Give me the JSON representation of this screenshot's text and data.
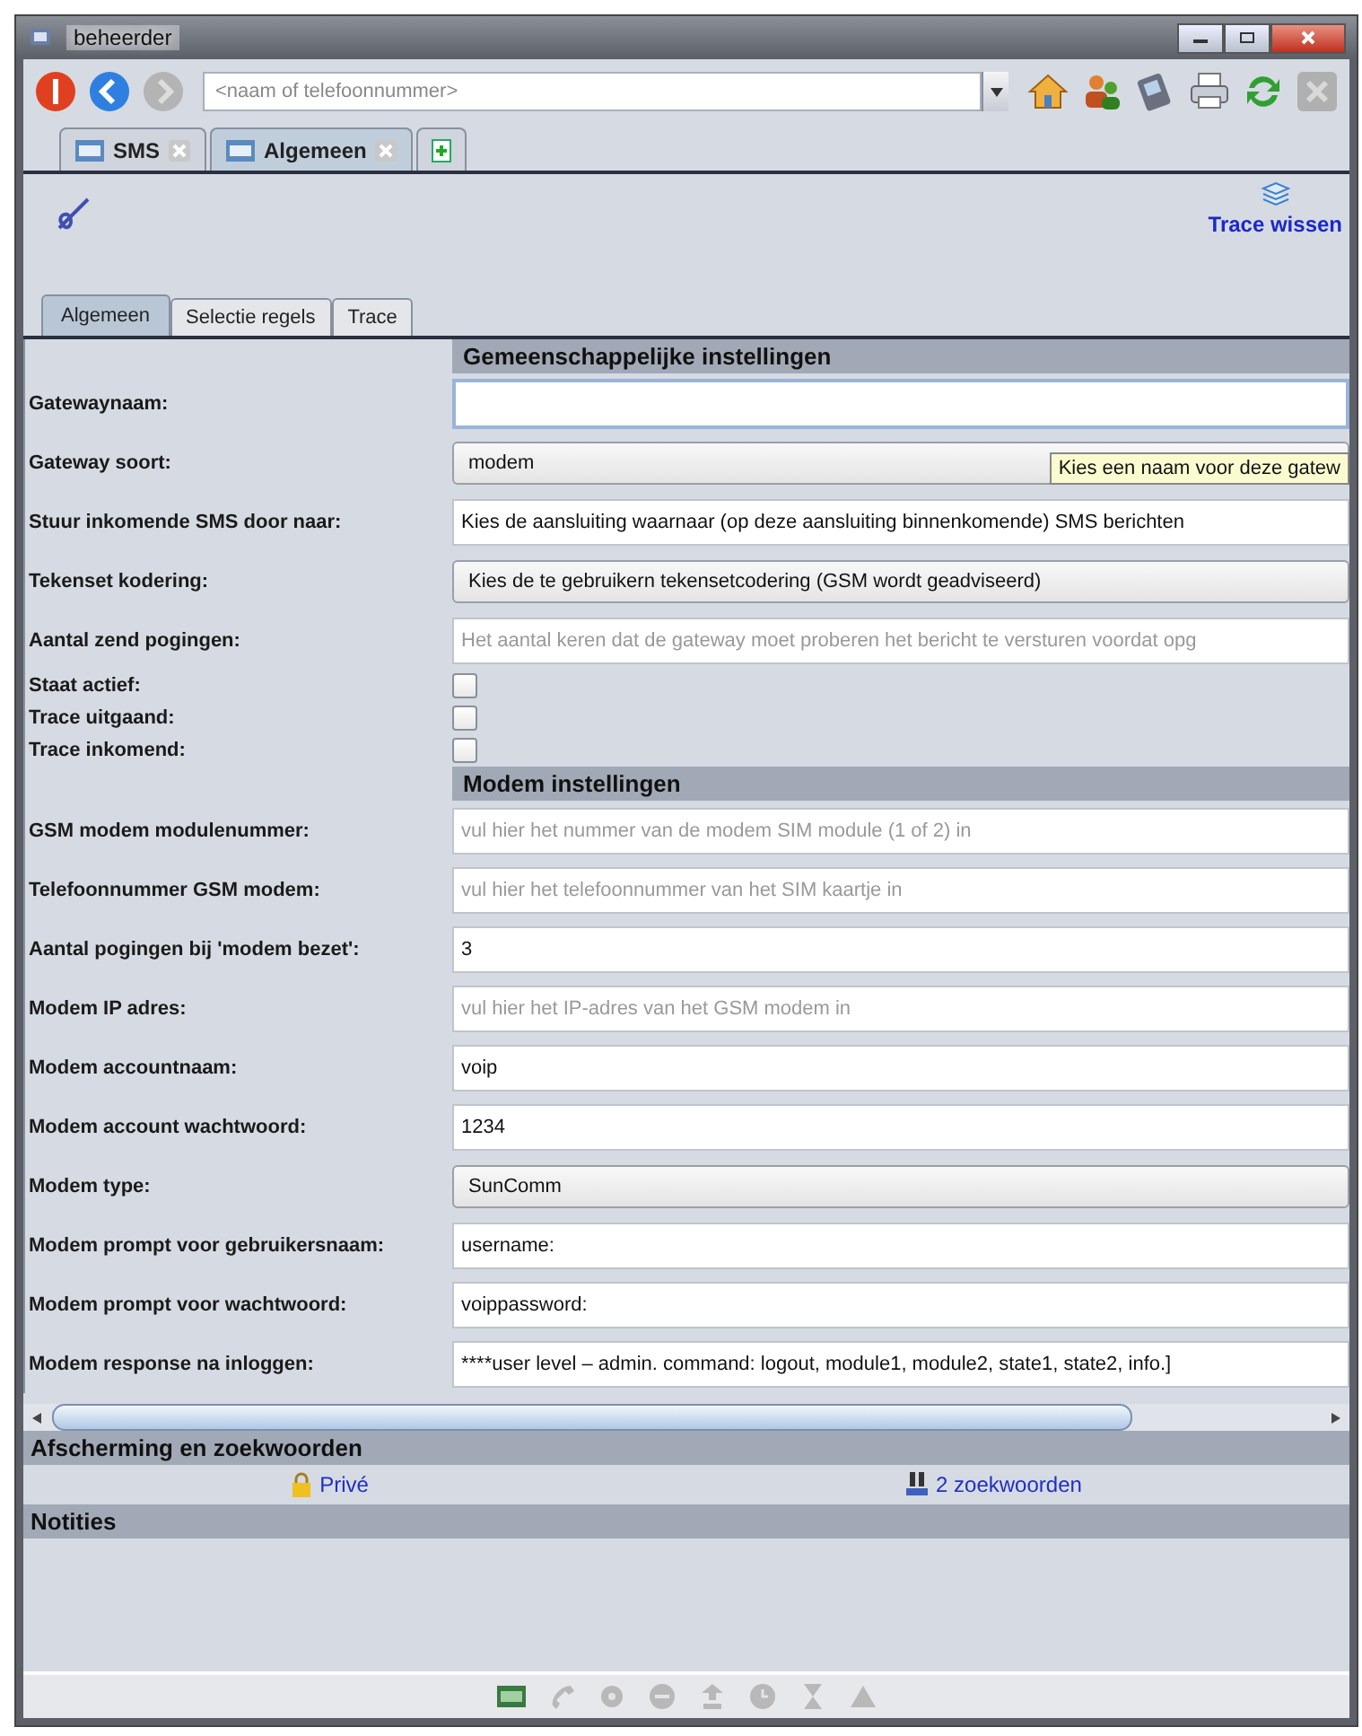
{
  "window": {
    "title": "beheerder"
  },
  "search": {
    "placeholder": "<naam of telefoonnummer>"
  },
  "tabs": [
    {
      "label": "SMS",
      "selected": false
    },
    {
      "label": "Algemeen",
      "selected": true
    }
  ],
  "clear_trace": "Trace wissen",
  "inner_tabs": [
    {
      "label": "Algemeen",
      "selected": true
    },
    {
      "label": "Selectie regels",
      "selected": false
    },
    {
      "label": "Trace",
      "selected": false
    }
  ],
  "sections": [
    {
      "title": "Gemeenschappelijke instellingen",
      "fields": [
        {
          "label": "Gatewaynaam:",
          "kind": "input",
          "focused": true
        },
        {
          "label": "Gateway soort:",
          "kind": "select",
          "value": "modem"
        },
        {
          "label": "Stuur inkomende SMS door naar:",
          "kind": "input",
          "value": "Kies de aansluiting waarnaar (op deze aansluiting binnenkomende) SMS berichten"
        },
        {
          "label": "Tekenset kodering:",
          "kind": "select",
          "value": "Kies de te gebruikern tekensetcodering (GSM wordt geadviseerd)"
        },
        {
          "label": "Aantal zend pogingen:",
          "kind": "input",
          "placeholder": "Het aantal keren dat de gateway moet proberen het bericht te versturen voordat opg"
        },
        {
          "label": "Staat actief:",
          "kind": "checkbox",
          "checked": false
        },
        {
          "label": "Trace uitgaand:",
          "kind": "checkbox",
          "checked": false
        },
        {
          "label": "Trace inkomend:",
          "kind": "checkbox",
          "checked": false
        }
      ]
    },
    {
      "title": "Modem instellingen",
      "fields": [
        {
          "label": "GSM modem modulenummer:",
          "kind": "input",
          "placeholder": "vul hier het nummer van de modem SIM module (1 of 2) in"
        },
        {
          "label": "Telefoonnummer GSM modem:",
          "kind": "input",
          "placeholder": "vul hier het telefoonnummer van het SIM kaartje in"
        },
        {
          "label": "Aantal pogingen bij 'modem bezet':",
          "kind": "input",
          "value": "3"
        },
        {
          "label": "Modem IP adres:",
          "kind": "input",
          "placeholder": "vul hier het IP-adres van het GSM modem in"
        },
        {
          "label": "Modem accountnaam:",
          "kind": "input",
          "value": "voip"
        },
        {
          "label": "Modem account wachtwoord:",
          "kind": "input",
          "value": "1234"
        },
        {
          "label": "Modem type:",
          "kind": "select",
          "value": "SunComm"
        },
        {
          "label": "Modem prompt voor gebruikersnaam:",
          "kind": "input",
          "value": "username:"
        },
        {
          "label": "Modem prompt voor wachtwoord:",
          "kind": "input",
          "value": "voippassword:"
        },
        {
          "label": "Modem response na inloggen:",
          "kind": "input",
          "value": "****user level – admin. command: logout, module1, module2, state1, state2, info.]"
        }
      ]
    }
  ],
  "tooltip": "Kies een naam voor deze gatew",
  "privacy": {
    "title": "Afscherming en zoekwoorden",
    "private_link": "Privé",
    "keywords_link": "2 zoekwoorden"
  },
  "notes": {
    "title": "Notities"
  }
}
